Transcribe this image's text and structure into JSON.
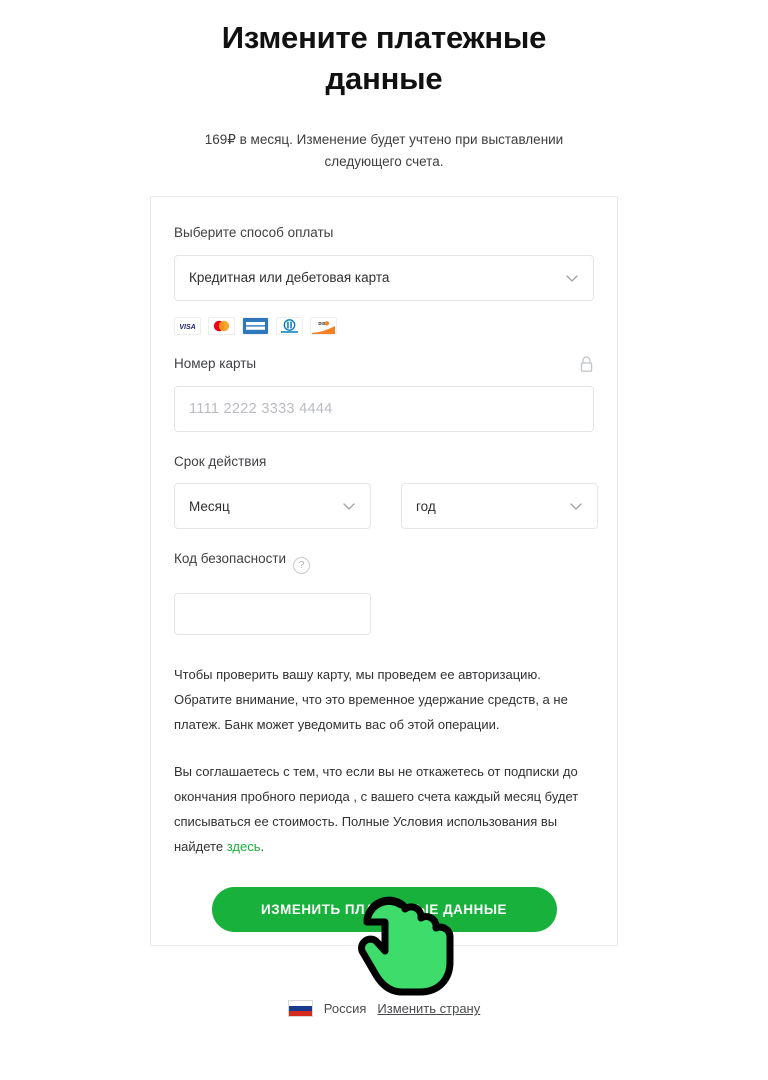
{
  "header": {
    "title": "Измените платежные данные",
    "subtitle": "169₽ в месяц. Изменение будет учтено при выставлении следующего счета."
  },
  "form": {
    "payment_method": {
      "label": "Выберите способ оплаты",
      "selected": "Кредитная или дебетовая карта",
      "chevron_icon": "chevron-down-icon"
    },
    "brands": [
      {
        "name": "visa",
        "label": "VISA"
      },
      {
        "name": "mastercard",
        "label": "mastercard"
      },
      {
        "name": "amex",
        "label": "AMERICAN EXPRESS"
      },
      {
        "name": "diners-club",
        "label": "Diners Club"
      },
      {
        "name": "discover",
        "label": "DISCOVER"
      }
    ],
    "card_number": {
      "label": "Номер карты",
      "placeholder": "1111 2222 3333 4444",
      "value": "",
      "lock_icon": "lock-icon"
    },
    "expiry": {
      "label": "Срок действия",
      "month_selected": "Месяц",
      "year_selected": "год"
    },
    "security_code": {
      "label": "Код безопасности",
      "help_icon": "?",
      "value": ""
    },
    "legal_1": "Чтобы проверить вашу карту, мы проведем ее авторизацию. Обратите внимание, что это временное удержание средств, а не платеж. Банк может уведомить вас об этой операции.",
    "legal_2_before": "Вы соглашаетесь с тем, что если вы не откажетесь от подписки до окончания пробного периода , с вашего счета каждый месяц будет списываться ее стоимость. Полные Условия использования вы найдете ",
    "legal_2_link": "здесь",
    "legal_2_after": ".",
    "submit_label": "ИЗМЕНИТЬ ПЛАТЕЖНЫЕ ДАННЫЕ"
  },
  "footer": {
    "flag_icon": "russia-flag-icon",
    "country": "Россия",
    "change_country_label": "Изменить страну"
  },
  "colors": {
    "accent_green": "#17b13b",
    "link_green": "#1bb039",
    "text_dark": "#111111",
    "border": "#e3e5e8"
  }
}
